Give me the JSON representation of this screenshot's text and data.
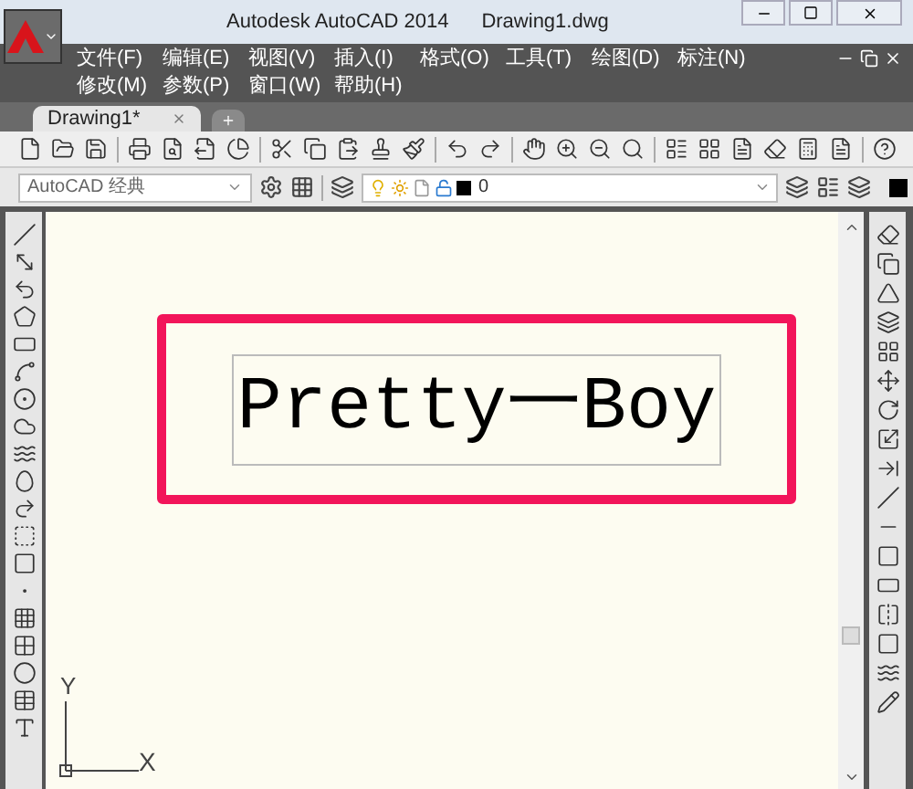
{
  "title_bar": {
    "app": "Autodesk AutoCAD 2014",
    "document": "Drawing1.dwg"
  },
  "menu_rows": [
    {
      "items": [
        {
          "label": "文件(F)"
        },
        {
          "label": "编辑(E)"
        },
        {
          "label": "视图(V)"
        },
        {
          "label": "插入(I)"
        },
        {
          "label": "格式(O)"
        },
        {
          "label": "工具(T)"
        },
        {
          "label": "绘图(D)"
        },
        {
          "label": "标注(N)"
        }
      ]
    },
    {
      "items": [
        {
          "label": "修改(M)"
        },
        {
          "label": "参数(P)"
        },
        {
          "label": "窗口(W)"
        },
        {
          "label": "帮助(H)"
        }
      ]
    }
  ],
  "tabs": [
    {
      "label": "Drawing1*",
      "selected": true
    }
  ],
  "workspace": {
    "value": "AutoCAD 经典"
  },
  "layer": {
    "value": "0"
  },
  "canvas": {
    "text": "Pretty一Boy",
    "highlighted": true
  },
  "ucs": {
    "y_label": "Y",
    "x_label": "X"
  }
}
